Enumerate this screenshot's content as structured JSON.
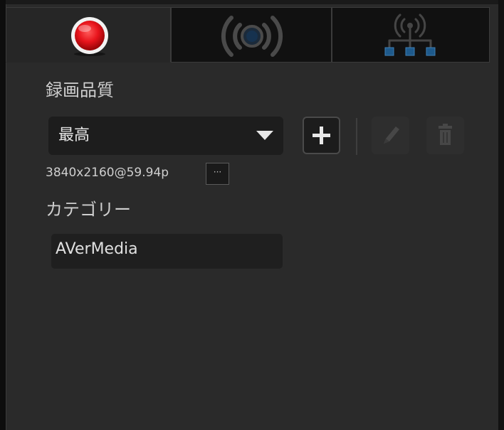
{
  "tabs": [
    {
      "name": "record",
      "icon": "record-icon",
      "active": true
    },
    {
      "name": "stream",
      "icon": "broadcast-icon",
      "active": false
    },
    {
      "name": "network",
      "icon": "network-icon",
      "active": false
    }
  ],
  "record_quality": {
    "label": "録画品質",
    "selected": "最高",
    "resolution": "3840x2160@59.94p",
    "more_label": "···"
  },
  "category": {
    "label": "カテゴリー",
    "value": "AVerMedia"
  },
  "colors": {
    "record_red": "#e8141c",
    "panel_bg": "#2a2a2a",
    "icon_gray": "#474747",
    "network_blue": "#1e5a8c"
  }
}
